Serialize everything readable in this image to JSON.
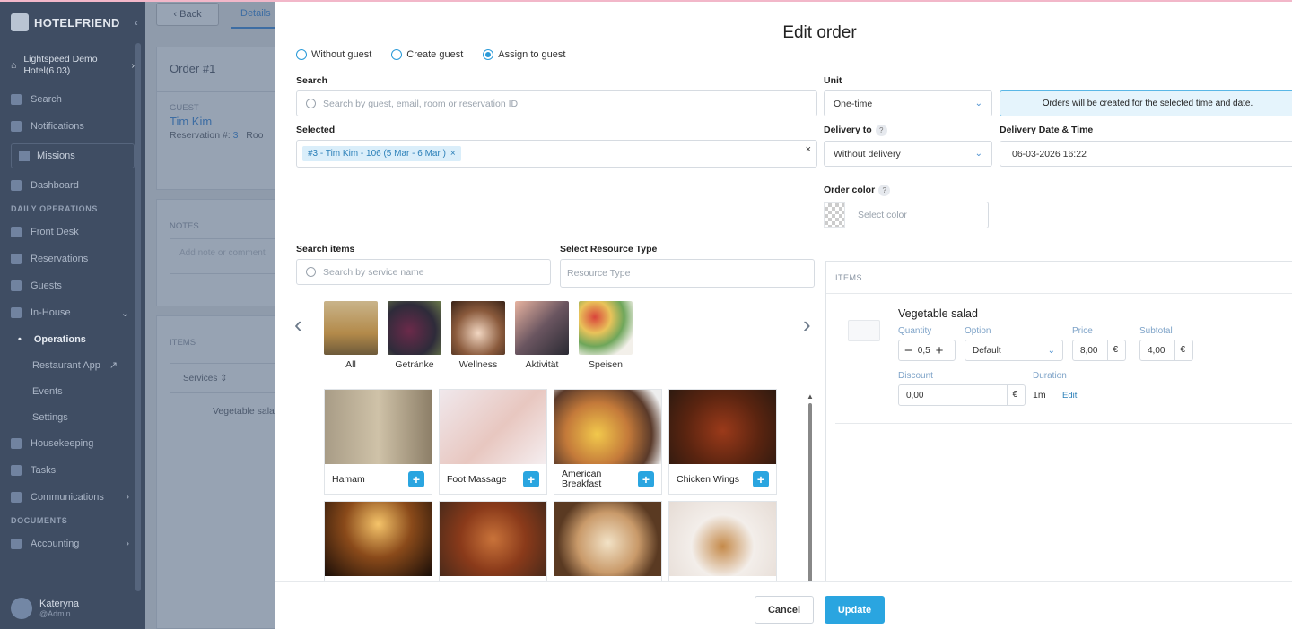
{
  "app": {
    "brand": "HOTELFRIEND",
    "hotel": "Lightspeed Demo Hotel(6.03)",
    "nav": {
      "search": "Search",
      "notifications": "Notifications",
      "missions": "Missions",
      "dashboard": "Dashboard",
      "section_daily": "DAILY OPERATIONS",
      "front_desk": "Front Desk",
      "reservations": "Reservations",
      "guests": "Guests",
      "in_house": "In-House",
      "operations": "Operations",
      "restaurant_app": "Restaurant App",
      "events": "Events",
      "settings": "Settings",
      "housekeeping": "Housekeeping",
      "tasks": "Tasks",
      "communications": "Communications",
      "section_documents": "DOCUMENTS",
      "accounting": "Accounting"
    },
    "user": {
      "name": "Kateryna",
      "role": "@Admin"
    }
  },
  "background": {
    "back_label": "Back",
    "tab_details": "Details",
    "order_title": "Order #1",
    "guest_label": "GUEST",
    "guest_name": "Tim Kim",
    "reservation_label": "Reservation #:",
    "reservation_value": "3",
    "room_label": "Roo",
    "notes_label": "NOTES",
    "notes_placeholder": "Add note or comment",
    "items_label": "ITEMS",
    "services_header": "Services",
    "item_text": "Vegetable sala"
  },
  "modal": {
    "title": "Edit order",
    "radios": [
      {
        "label": "Without guest",
        "selected": false
      },
      {
        "label": "Create guest",
        "selected": false
      },
      {
        "label": "Assign to guest",
        "selected": true
      }
    ],
    "search": {
      "label": "Search",
      "placeholder": "Search by guest, email, room or reservation ID"
    },
    "selected": {
      "label": "Selected",
      "tag": "#3 - Tim Kim - 106 (5 Mar - 6 Mar )",
      "clear": "×"
    },
    "unit": {
      "label": "Unit",
      "value": "One-time"
    },
    "info": "Orders will be created for the selected time and date.",
    "delivery_to": {
      "label": "Delivery to",
      "value": "Without delivery"
    },
    "delivery_date": {
      "label": "Delivery Date & Time",
      "value": "06-03-2026 16:22"
    },
    "order_color": {
      "label": "Order color",
      "placeholder": "Select color"
    },
    "search_items": {
      "label": "Search items",
      "placeholder": "Search by service name"
    },
    "resource_type": {
      "label": "Select Resource Type",
      "placeholder": "Resource Type"
    },
    "categories": [
      "All",
      "Getränke",
      "Wellness",
      "Aktivität",
      "Speisen"
    ],
    "products": [
      {
        "name": "Hamam"
      },
      {
        "name": "Foot Massage"
      },
      {
        "name": "American Breakfast"
      },
      {
        "name": "Chicken Wings"
      },
      {
        "name": ""
      },
      {
        "name": ""
      },
      {
        "name": ""
      },
      {
        "name": ""
      }
    ],
    "items_panel": {
      "header": "ITEMS",
      "item": {
        "name": "Vegetable salad",
        "quantity_label": "Quantity",
        "quantity": "0,5",
        "option_label": "Option",
        "option": "Default",
        "price_label": "Price",
        "price": "8,00",
        "subtotal_label": "Subtotal",
        "subtotal": "4,00",
        "currency": "€",
        "discount_label": "Discount",
        "discount": "0,00",
        "duration_label": "Duration",
        "duration": "1m",
        "edit": "Edit"
      }
    },
    "buttons": {
      "cancel": "Cancel",
      "update": "Update"
    }
  },
  "colors": {
    "accent": "#2aa5e0",
    "sidebar": "#3f4d63",
    "overlay_bg": "#8f9bab",
    "info_bg": "#e5f4fc"
  }
}
